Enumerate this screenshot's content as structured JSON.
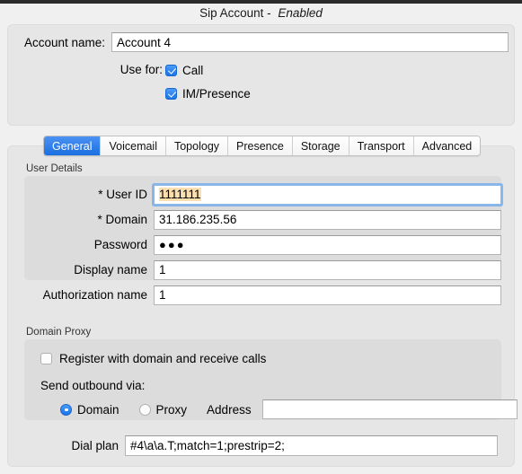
{
  "window": {
    "title_main": "Sip Account - ",
    "title_status": "Enabled"
  },
  "account": {
    "name_label": "Account name:",
    "name_value": "Account 4",
    "use_for_label": "Use for:",
    "use_for": [
      {
        "label": "Call",
        "checked": true
      },
      {
        "label": "IM/Presence",
        "checked": true
      }
    ]
  },
  "tabs": [
    {
      "label": "General",
      "active": true
    },
    {
      "label": "Voicemail",
      "active": false
    },
    {
      "label": "Topology",
      "active": false
    },
    {
      "label": "Presence",
      "active": false
    },
    {
      "label": "Storage",
      "active": false
    },
    {
      "label": "Transport",
      "active": false
    },
    {
      "label": "Advanced",
      "active": false
    }
  ],
  "user_details": {
    "group_title": "User Details",
    "fields": [
      {
        "label": "* User ID",
        "value": "1111111",
        "focused": true,
        "selected": true
      },
      {
        "label": "* Domain",
        "value": "31.186.235.56",
        "focused": false,
        "selected": false
      },
      {
        "label": "Password",
        "value": "●●●",
        "focused": false,
        "selected": false
      },
      {
        "label": "Display name",
        "value": "1",
        "focused": false,
        "selected": false
      },
      {
        "label": "Authorization name",
        "value": "1",
        "focused": false,
        "selected": false
      }
    ]
  },
  "domain_proxy": {
    "group_title": "Domain Proxy",
    "register_label": "Register with domain and receive calls",
    "register_checked": false,
    "send_outbound_label": "Send outbound via:",
    "radio_domain_label": "Domain",
    "radio_proxy_label": "Proxy",
    "selected_radio": "Domain",
    "address_label": "Address",
    "address_value": "",
    "address_placeholder": ""
  },
  "dial_plan": {
    "label": "Dial plan",
    "value": "#4\\a\\a.T;match=1;prestrip=2;"
  },
  "colors": {
    "accent": "#1a74e8",
    "window_bg": "#f0f0f0",
    "panel_bg": "#e6e6e6",
    "group_bg": "#dcdcdc",
    "selection_highlight": "#fbdfb0",
    "titlebar": "#2b2b2b"
  }
}
